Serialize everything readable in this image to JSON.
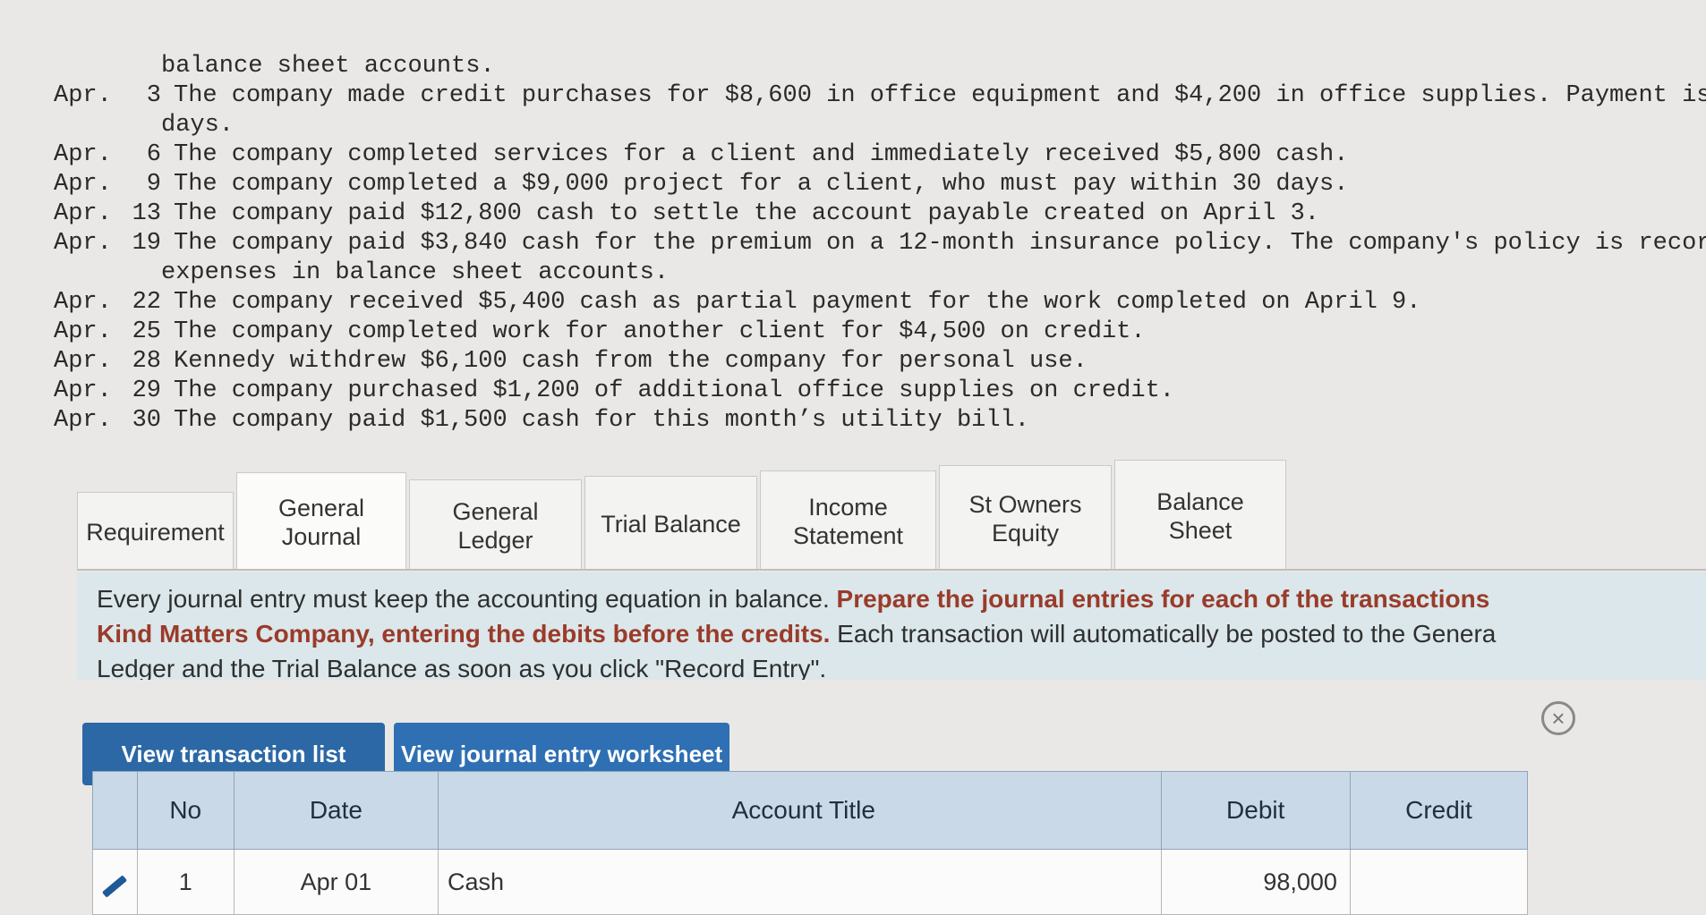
{
  "problem_lines": [
    {
      "date": "",
      "num": "",
      "text": "balance sheet accounts.",
      "continuation": true
    },
    {
      "date": "Apr.",
      "num": "3",
      "text": "The company made credit purchases for $8,600 in office equipment and $4,200 in office supplies. Payment is due wit"
    },
    {
      "date": "",
      "num": "",
      "text": "days.",
      "continuation": true
    },
    {
      "date": "Apr.",
      "num": "6",
      "text": "The company completed services for a client and immediately received $5,800 cash."
    },
    {
      "date": "Apr.",
      "num": "9",
      "text": "The company completed a $9,000 project for a client, who must pay within 30 days."
    },
    {
      "date": "Apr.",
      "num": "13",
      "text": "The company paid $12,800 cash to settle the account payable created on April 3."
    },
    {
      "date": "Apr.",
      "num": "19",
      "text": "The company paid $3,840 cash for the premium on a 12-month insurance policy. The company's policy is record prepai"
    },
    {
      "date": "",
      "num": "",
      "text": "expenses in balance sheet accounts.",
      "continuation": true
    },
    {
      "date": "Apr.",
      "num": "22",
      "text": "The company received $5,400 cash as partial payment for the work completed on April 9."
    },
    {
      "date": "Apr.",
      "num": "25",
      "text": "The company completed work for another client for $4,500 on credit."
    },
    {
      "date": "Apr.",
      "num": "28",
      "text": "Kennedy withdrew $6,100 cash from the company for personal use."
    },
    {
      "date": "Apr.",
      "num": "29",
      "text": "The company purchased $1,200 of additional office supplies on credit."
    },
    {
      "date": "Apr.",
      "num": "30",
      "text": "The company paid $1,500 cash for this month’s utility bill."
    }
  ],
  "tabs": [
    {
      "lines": [
        "Requirement"
      ],
      "active": false
    },
    {
      "lines": [
        "General",
        "Journal"
      ],
      "active": true
    },
    {
      "lines": [
        "General",
        "Ledger"
      ],
      "active": false
    },
    {
      "lines": [
        "Trial Balance"
      ],
      "active": false
    },
    {
      "lines": [
        "Income",
        "Statement"
      ],
      "active": false
    },
    {
      "lines": [
        "St Owners",
        "Equity"
      ],
      "active": false
    },
    {
      "lines": [
        "Balance Sheet"
      ],
      "active": false
    }
  ],
  "instructions": {
    "part1": "Every journal entry must keep the accounting equation in balance. ",
    "bold1": "Prepare the journal entries for each of the transactions",
    "bold2": "Kind Matters Company, entering the debits before the credits.",
    "part2": " Each transaction will automatically be posted to the Genera",
    "part3": "Ledger and the Trial Balance as soon as you click \"Record Entry\"."
  },
  "buttons": {
    "view_transaction_list": "View transaction list",
    "view_journal_worksheet": "View journal entry worksheet",
    "close_symbol": "×"
  },
  "table": {
    "headers": {
      "no": "No",
      "date": "Date",
      "account_title": "Account Title",
      "debit": "Debit",
      "credit": "Credit"
    },
    "rows": [
      {
        "no": "1",
        "date": "Apr 01",
        "account": "Cash",
        "debit": "98,000",
        "credit": ""
      }
    ]
  }
}
